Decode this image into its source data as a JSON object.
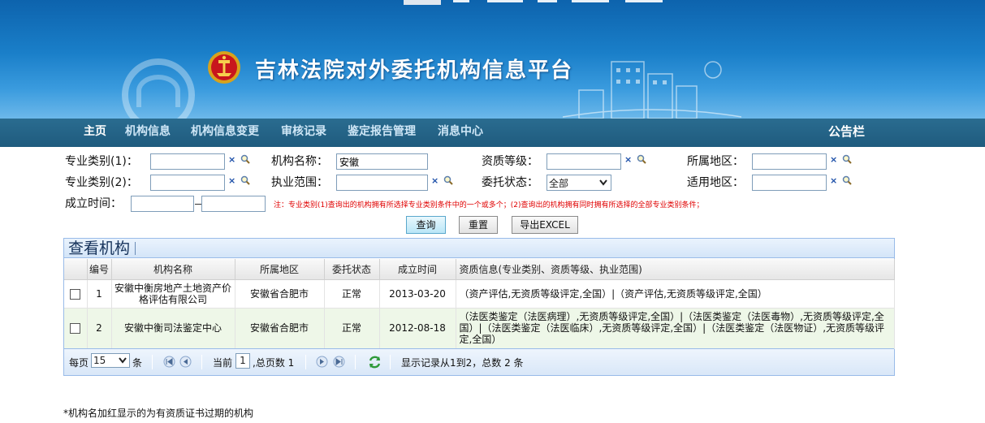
{
  "header": {
    "site_title": "吉林法院对外委托机构信息平台"
  },
  "nav": {
    "items": [
      {
        "label": "主页"
      },
      {
        "label": "机构信息"
      },
      {
        "label": "机构信息变更"
      },
      {
        "label": "审核记录"
      },
      {
        "label": "鉴定报告管理"
      },
      {
        "label": "消息中心"
      }
    ],
    "notice": "公告栏"
  },
  "search": {
    "specialty1_label": "专业类别(1)：",
    "specialty1_value": "",
    "specialty2_label": "专业类别(2)：",
    "specialty2_value": "",
    "org_name_label": "机构名称：",
    "org_name_value": "安徽",
    "practice_scope_label": "执业范围：",
    "practice_scope_value": "",
    "qualification_label": "资质等级：",
    "qualification_value": "",
    "entrust_status_label": "委托状态：",
    "entrust_status_value": "全部",
    "region_label": "所属地区：",
    "region_value": "",
    "applicable_region_label": "适用地区：",
    "applicable_region_value": "",
    "established_label": "成立时间：",
    "established_from": "",
    "established_to": "",
    "clear_symbol": "×",
    "note": "注：专业类别(1)查询出的机构拥有所选择专业类别条件中的一个或多个；(2)查询出的机构拥有同时拥有所选择的全部专业类别条件；",
    "query_button": "查询",
    "reset_button": "重置",
    "export_button": "导出EXCEL"
  },
  "grid": {
    "title": "查看机构",
    "columns": [
      "编号",
      "机构名称",
      "所属地区",
      "委托状态",
      "成立时间",
      "资质信息(专业类别、资质等级、执业范围)"
    ],
    "rows": [
      {
        "no": "1",
        "name": "安徽中衡房地产土地资产价格评估有限公司",
        "region": "安徽省合肥市",
        "status": "正常",
        "established": "2013-03-20",
        "qualification": "（资产评估,无资质等级评定,全国）|（资产评估,无资质等级评定,全国）"
      },
      {
        "no": "2",
        "name": "安徽中衡司法鉴定中心",
        "region": "安徽省合肥市",
        "status": "正常",
        "established": "2012-08-18",
        "qualification": "（法医类鉴定（法医病理）,无资质等级评定,全国）|（法医类鉴定（法医毒物）,无资质等级评定,全国）|（法医类鉴定（法医临床）,无资质等级评定,全国）|（法医类鉴定（法医物证）,无资质等级评定,全国）"
      }
    ]
  },
  "pager": {
    "per_page_label": "每页",
    "per_page_value": "15",
    "per_page_unit": "条",
    "current_label": "当前",
    "current_page": "1",
    "total_pages_text": ",总页数 1",
    "summary": "显示记录从1到2，总数 2 条"
  },
  "footer_note": "*机构名加红显示的为有资质证书过期的机构",
  "colors": {
    "header_blue": "#1a7fc9",
    "nav_bg": "#1f5b7e",
    "note_red": "#e00000",
    "row_alt": "#eef7e8"
  }
}
